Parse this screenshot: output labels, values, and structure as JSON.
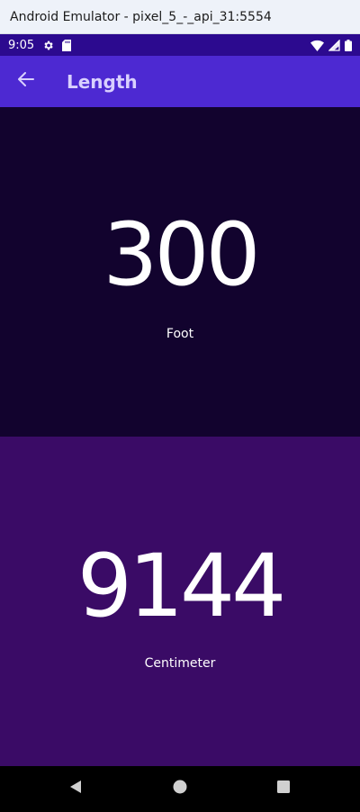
{
  "window": {
    "title": "Android Emulator - pixel_5_-_api_31:5554"
  },
  "status_bar": {
    "time": "9:05",
    "icons_left": [
      "gear-icon",
      "sd-card-icon"
    ],
    "icons_right": [
      "wifi-icon",
      "cell-signal-icon",
      "battery-icon"
    ]
  },
  "app_bar": {
    "title": "Length",
    "back_icon": "arrow-left-icon"
  },
  "converter": {
    "top": {
      "value": "300",
      "unit": "Foot"
    },
    "bottom": {
      "value": "9144",
      "unit": "Centimeter"
    }
  },
  "nav_bar": {
    "buttons": [
      "back-triangle-icon",
      "home-circle-icon",
      "recents-square-icon"
    ]
  },
  "colors": {
    "status_bar": "#2c0a8f",
    "app_bar": "#4d29d2",
    "top_panel": "#12032e",
    "bottom_panel": "#3a0b66",
    "nav_bar": "#000000"
  }
}
